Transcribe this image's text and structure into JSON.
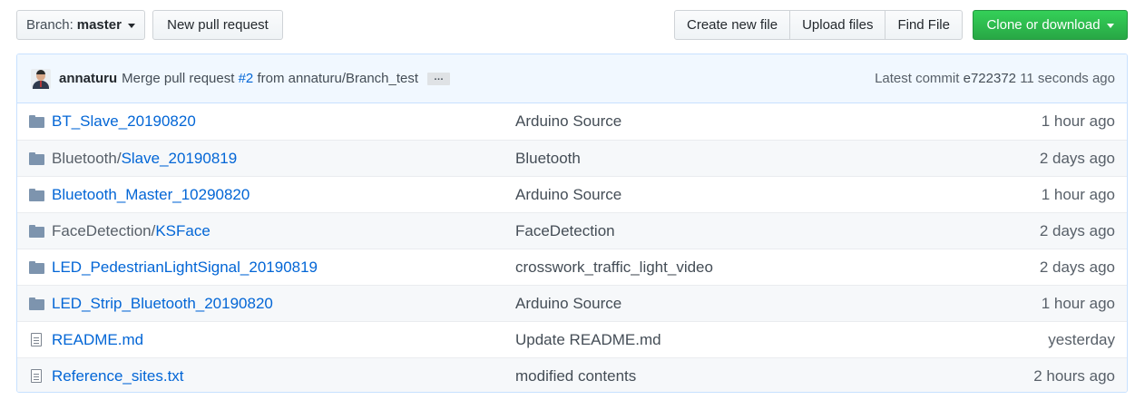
{
  "toolbar": {
    "branch_label": "Branch:",
    "branch_value": "master",
    "new_pull_request": "New pull request",
    "create_new_file": "Create new file",
    "upload_files": "Upload files",
    "find_file": "Find File",
    "clone_or_download": "Clone or download"
  },
  "commit": {
    "author": "annaturu",
    "message_prefix": "Merge pull request",
    "pr_link": "#2",
    "message_suffix": "from annaturu/Branch_test",
    "ellipsis": "…",
    "latest_label": "Latest commit",
    "sha": "e722372",
    "age": "11 seconds ago"
  },
  "files": [
    {
      "type": "folder",
      "dir": "",
      "name": "BT_Slave_20190820",
      "message": "Arduino Source",
      "age": "1 hour ago"
    },
    {
      "type": "folder",
      "dir": "Bluetooth/",
      "name": "Slave_20190819",
      "message": "Bluetooth",
      "age": "2 days ago"
    },
    {
      "type": "folder",
      "dir": "",
      "name": "Bluetooth_Master_10290820",
      "message": "Arduino Source",
      "age": "1 hour ago"
    },
    {
      "type": "folder",
      "dir": "FaceDetection/",
      "name": "KSFace",
      "message": "FaceDetection",
      "age": "2 days ago"
    },
    {
      "type": "folder",
      "dir": "",
      "name": "LED_PedestrianLightSignal_20190819",
      "message": "crosswork_traffic_light_video",
      "age": "2 days ago"
    },
    {
      "type": "folder",
      "dir": "",
      "name": "LED_Strip_Bluetooth_20190820",
      "message": "Arduino Source",
      "age": "1 hour ago"
    },
    {
      "type": "file",
      "dir": "",
      "name": "README.md",
      "message": "Update README.md",
      "age": "yesterday"
    },
    {
      "type": "file",
      "dir": "",
      "name": "Reference_sites.txt",
      "message": "modified contents",
      "age": "2 hours ago"
    }
  ]
}
